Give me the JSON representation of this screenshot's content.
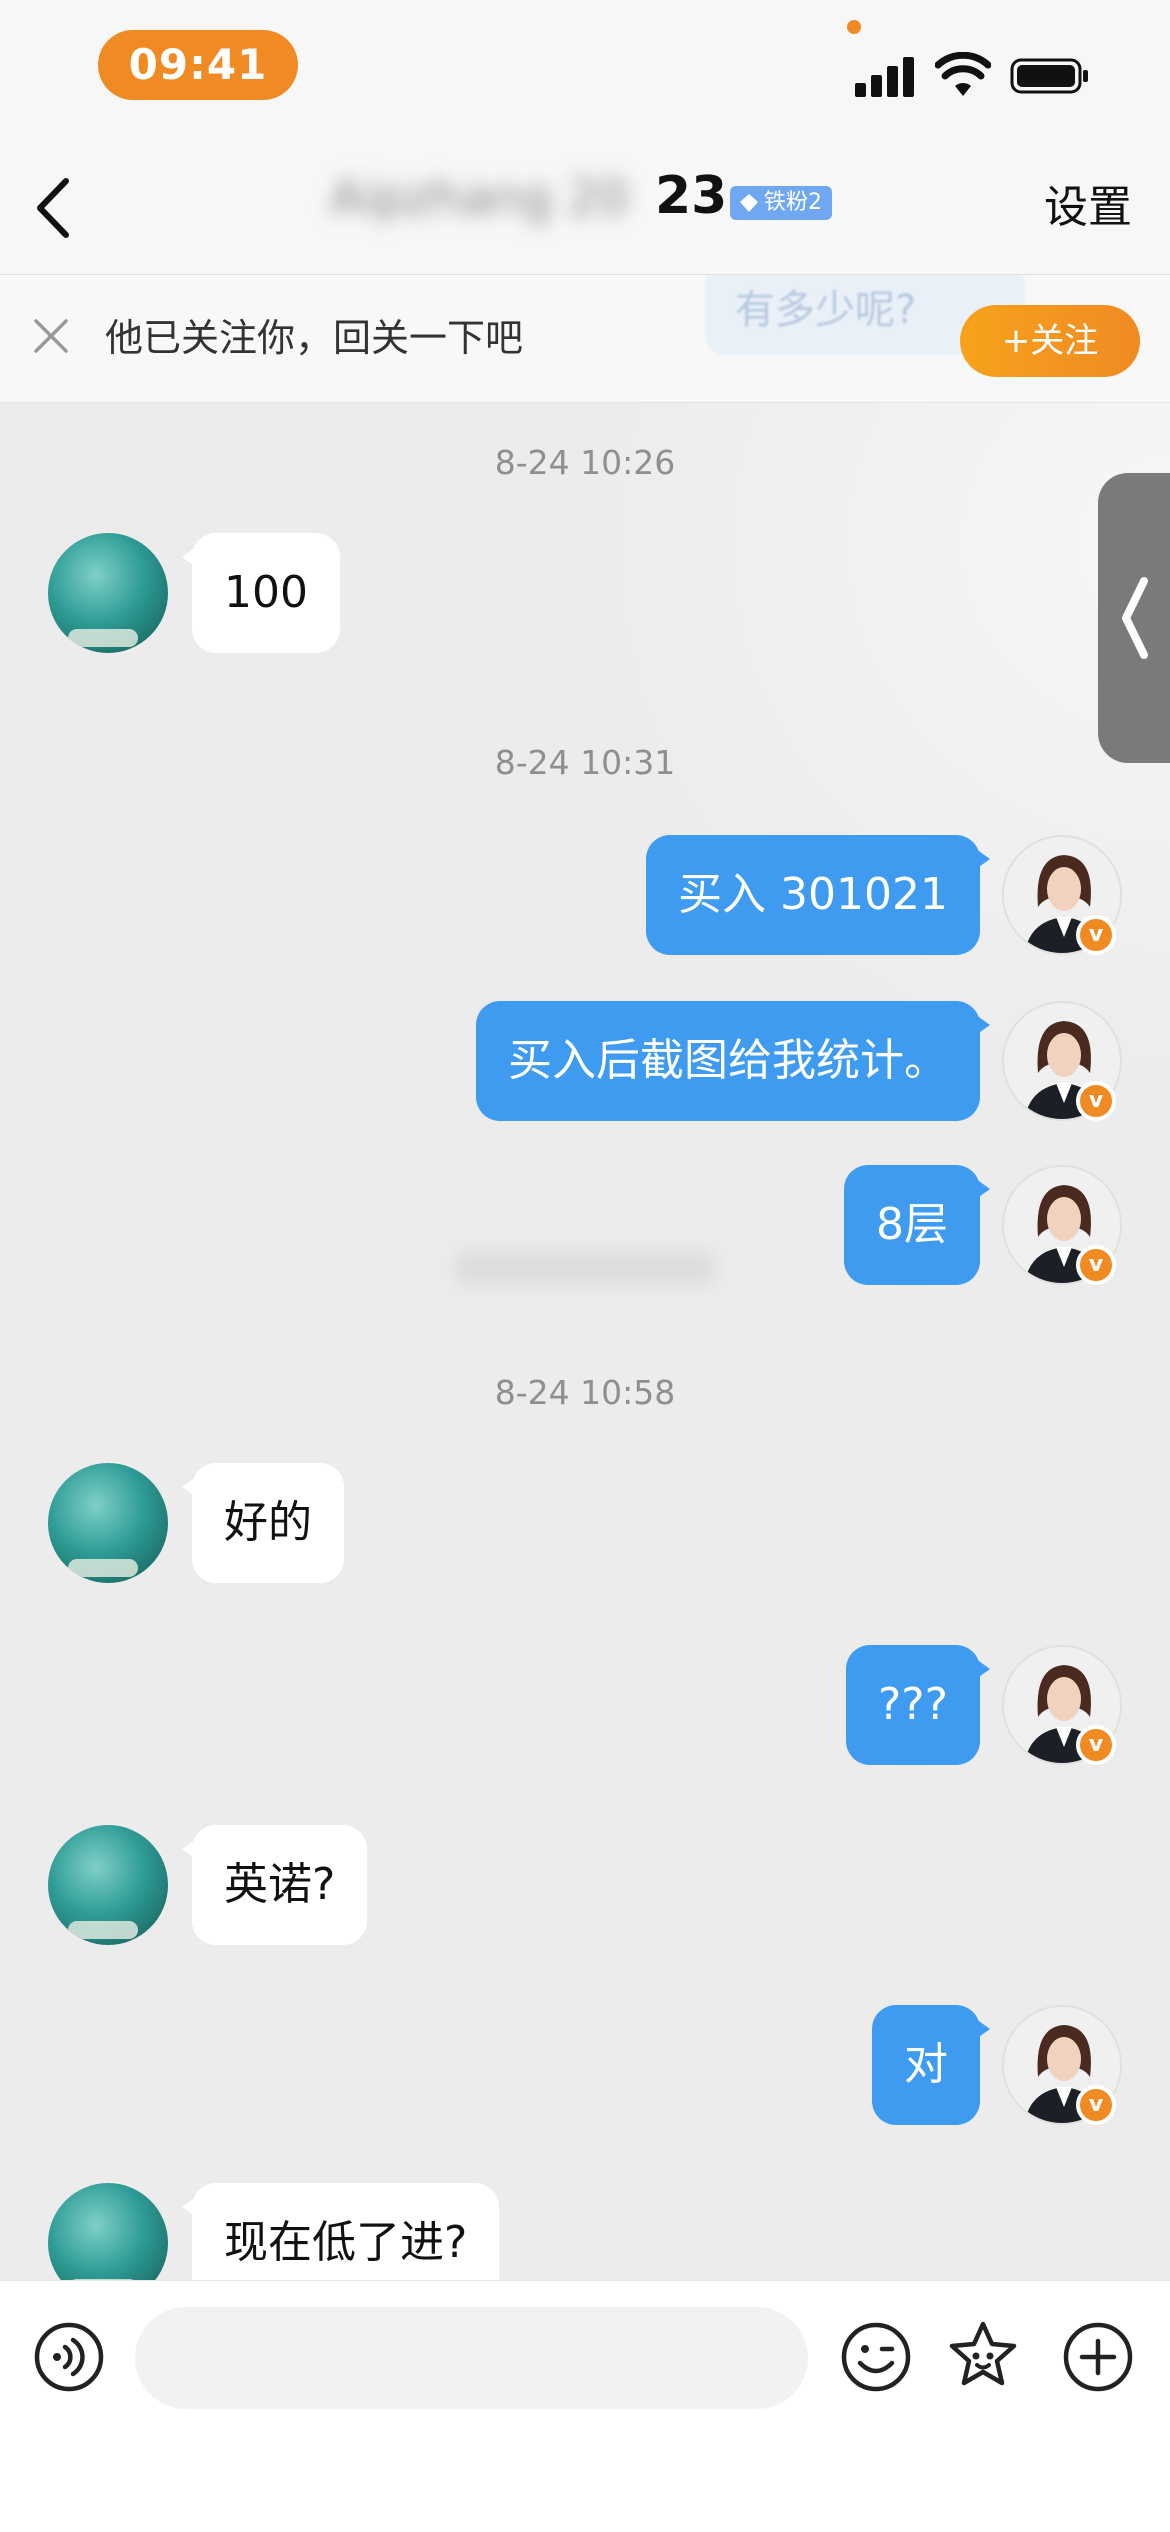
{
  "status_bar": {
    "time": "09:41"
  },
  "nav": {
    "back_label": "<",
    "title_blurred": "Aipzhang 20",
    "title_visible": "23",
    "badge": "铁粉2",
    "settings": "设置"
  },
  "follow_bar": {
    "tip": "他已关注你，回关一下吧",
    "button": "+关注",
    "ghost_text": "有多少呢?"
  },
  "messages": [
    {
      "type": "timestamp",
      "text": "8-24 10:26"
    },
    {
      "type": "received",
      "text": "100"
    },
    {
      "type": "timestamp",
      "text": "8-24 10:31"
    },
    {
      "type": "sent",
      "text": "买入 301021"
    },
    {
      "type": "sent",
      "text": "买入后截图给我统计。"
    },
    {
      "type": "sent",
      "text": "8层"
    },
    {
      "type": "timestamp",
      "text": "8-24 10:58"
    },
    {
      "type": "received",
      "text": "好的"
    },
    {
      "type": "sent",
      "text": "???"
    },
    {
      "type": "received",
      "text": "英诺?"
    },
    {
      "type": "sent",
      "text": "对"
    },
    {
      "type": "received",
      "text": "现在低了进?"
    }
  ],
  "input_bar": {
    "placeholder": ""
  },
  "colors": {
    "accent": "#f08a22",
    "sent_bubble": "#3e9bf0",
    "chat_bg": "#ececec"
  },
  "icons": [
    "voice-icon",
    "emoji-icon",
    "sticker-icon",
    "plus-icon",
    "back-icon",
    "close-icon",
    "v-badge-icon"
  ]
}
